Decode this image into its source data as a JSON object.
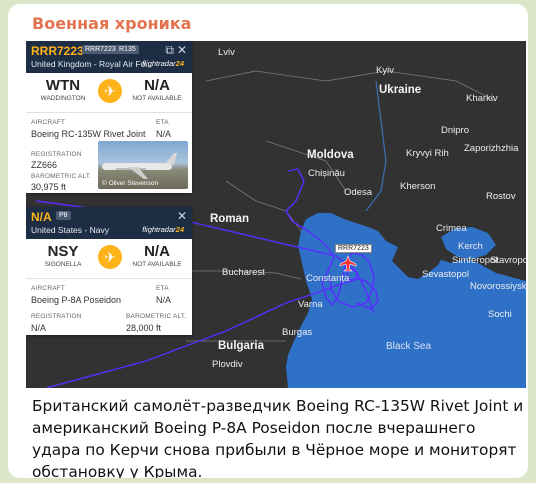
{
  "channel": {
    "name": "Военная хроника"
  },
  "map": {
    "labels": {
      "lviv": "Lviv",
      "kyiv": "Kyiv",
      "ukraine": "Ukraine",
      "kharkiv": "Kharkiv",
      "moldova": "Moldova",
      "odesa": "Odesa",
      "kryvyi_rih": "Kryvyi Rih",
      "dnipro": "Dnipro",
      "zaporizhzhia": "Zaporizhzhia",
      "kherson": "Kherson",
      "chisinau": "Chișinău",
      "romania": "Roman",
      "bucharest": "Bucharest",
      "constanta": "Constanța",
      "varna": "Varna",
      "burgas": "Burgas",
      "bulgaria": "Bulgaria",
      "plovdiv": "Plovdiv",
      "sevastopol": "Sevastopol",
      "simferopol": "Simferopol",
      "novorossiysk": "Novorossiysk",
      "sochi": "Sochi",
      "kerch": "Kerch",
      "crimea": "Crimea",
      "stavropol": "Stavropol",
      "rostov": "Rostov",
      "black_sea": "Black Sea"
    },
    "aircraft_label": "RRR7223"
  },
  "cards": [
    {
      "callsign": "RRR7223",
      "tag1": "RRR7223",
      "tag2": "R135",
      "owner": "United Kingdom - Royal Air Fo...",
      "brand_a": "flightradar",
      "brand_b": "24",
      "from_code": "WTN",
      "from_name": "WADDINGTON",
      "to_code": "N/A",
      "to_name": "NOT AVAILABLE",
      "aircraft_label": "AIRCRAFT",
      "aircraft": "Boeing RC-135W Rivet Joint",
      "eta_label": "ETA",
      "eta": "N/A",
      "registration_label": "REGISTRATION",
      "registration": "ZZ666",
      "baro_label": "BAROMETRIC ALT.",
      "baro": "30,975 ft",
      "photo_credit": "© Oliver Stevenson"
    },
    {
      "callsign": "N/A",
      "tag1": "P8",
      "owner": "United States - Navy",
      "brand_a": "flightradar",
      "brand_b": "24",
      "from_code": "NSY",
      "from_name": "SIGONELLA",
      "to_code": "N/A",
      "to_name": "NOT AVAILABLE",
      "aircraft_label": "AIRCRAFT",
      "aircraft": "Boeing P-8A Poseidon",
      "eta_label": "ETA",
      "eta": "N/A",
      "registration_label": "REGISTRATION",
      "registration": "N/A",
      "baro_label": "BAROMETRIC ALT.",
      "baro": "28,000 ft"
    }
  ],
  "caption": "Британский самолёт-разведчик Boeing RC-135W Rivet Joint и американский Boeing P-8A Poseidon после вчерашнего удара по Керчи снова прибыли в Чёрное море и мониторят обстановку у Крыма.",
  "colors": {
    "accent": "#e2734f",
    "land": "#323232",
    "sea": "#2f71c7",
    "track": "#5a2cff",
    "flightradar": "#ffb31a"
  }
}
